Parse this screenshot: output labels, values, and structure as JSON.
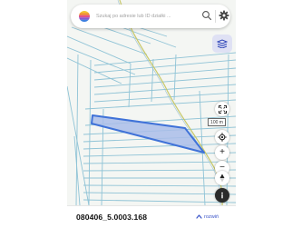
{
  "search": {
    "placeholder": "Szukaj po adresie lub ID działki ..."
  },
  "map": {
    "scale_label": "100 m",
    "zoom_in_label": "+",
    "zoom_out_label": "−",
    "selected_parcel_color": "#3f72d8",
    "selected_parcel_fill": "#a9bde9",
    "parcel_line_color": "#8fc3d6",
    "road_color": "#c8c86a"
  },
  "parcel_panel": {
    "parcel_id": "080406_5.0003.168",
    "expand_label": "rozwiń"
  },
  "icons": {
    "logo": "app-logo",
    "search": "search-icon",
    "settings": "gear-icon",
    "layers": "layers-icon",
    "fullscreen": "fullscreen-icon",
    "locate": "gps-icon",
    "compass": "compass-icon",
    "info": "info-icon",
    "expand": "expand-icon"
  },
  "colors": {
    "accent": "#3b55c9",
    "layers_button_bg": "#dfe1f4"
  }
}
